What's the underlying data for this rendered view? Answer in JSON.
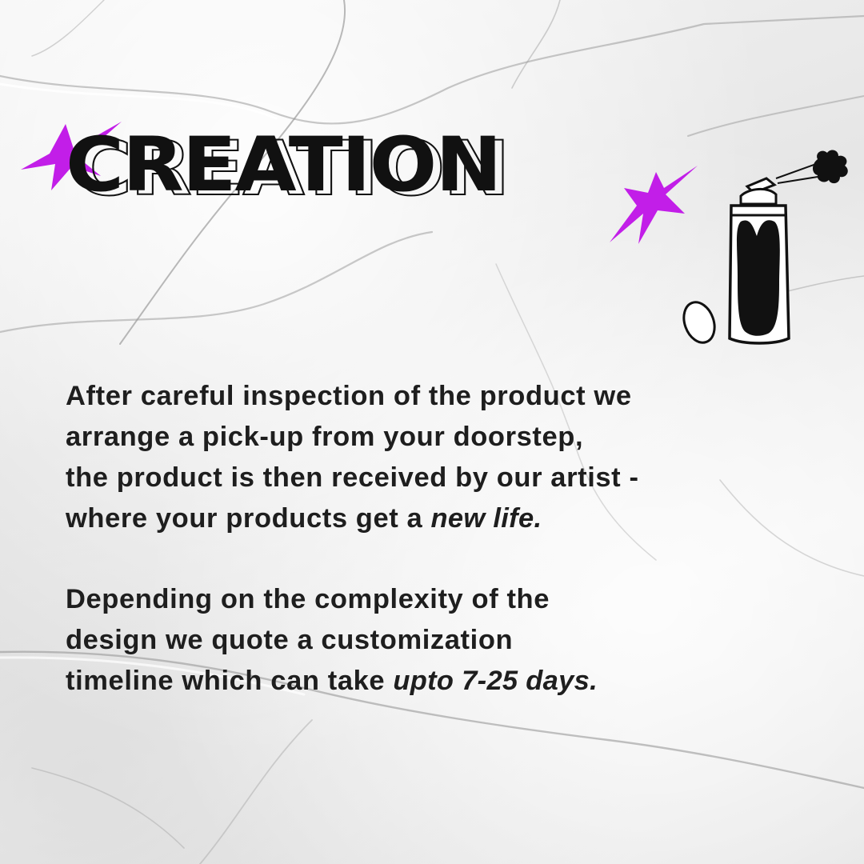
{
  "title": "CREATION",
  "colors": {
    "accent": "#c21ee8",
    "ink": "#111111",
    "text": "#1e1e1e",
    "paper": "#ececec"
  },
  "icons": {
    "star": "sparkle-star-icon",
    "spray": "spray-can-icon"
  },
  "paragraph1": {
    "line1": "After careful inspection of the product we",
    "line2": "arrange a pick-up from your doorstep,",
    "line3": "the product is then received by our artist -",
    "line4_text": "where your products get a ",
    "line4_emphasis": "new life."
  },
  "paragraph2": {
    "line1": "Depending on the complexity of the",
    "line2": "design we quote a customization",
    "line3_text": "timeline which can take ",
    "line3_emphasis": "upto 7-25 days."
  }
}
